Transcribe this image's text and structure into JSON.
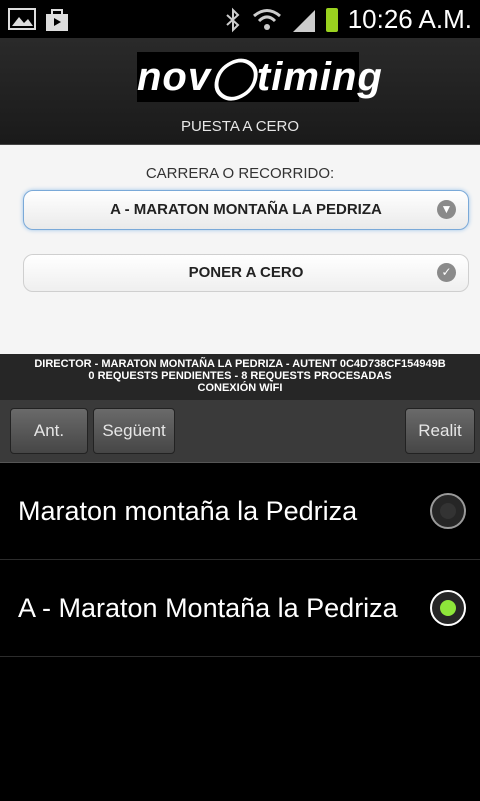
{
  "status_bar": {
    "time": "10:26 A.M.",
    "icons": [
      "gallery-icon",
      "bag-icon",
      "bluetooth-icon",
      "wifi-icon",
      "signal-icon",
      "battery-icon"
    ],
    "battery_color": "#9ad21f"
  },
  "header": {
    "logo": "nov◯timing",
    "subtitle": "PUESTA A CERO"
  },
  "form": {
    "label": "CARRERA O RECORRIDO:",
    "selected_race": "A - MARATON MONTAÑA LA PEDRIZA",
    "reset_button": "PONER A CERO"
  },
  "info_bar": {
    "line1": "DIRECTOR - MARATON MONTAÑA LA PEDRIZA - AUTENT 0C4D738CF154949B",
    "line2": "0 REQUESTS PENDIENTES - 8 REQUESTS PROCESADAS",
    "line3": "CONEXIÓN WIFI"
  },
  "toolbar": {
    "prev": "Ant.",
    "next": "Següent",
    "done": "Realit"
  },
  "list": {
    "items": [
      {
        "label": "Maraton montaña la Pedriza",
        "selected": false
      },
      {
        "label": "A - Maraton Montaña la Pedriza",
        "selected": true
      }
    ],
    "selected_color": "#8ee63a"
  }
}
